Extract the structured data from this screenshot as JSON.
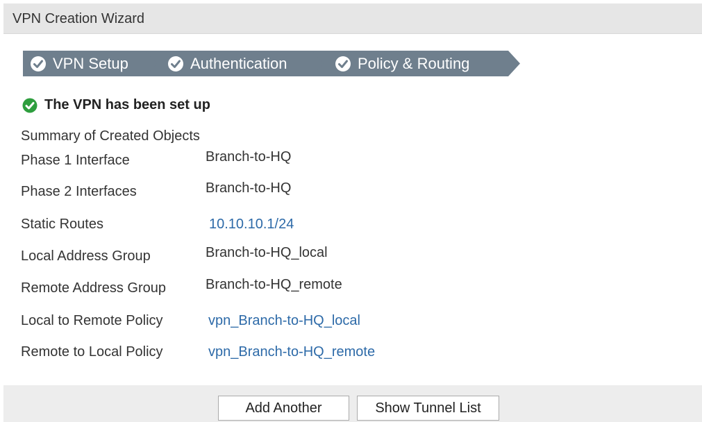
{
  "window": {
    "title": "VPN Creation Wizard"
  },
  "steps": [
    {
      "label": "VPN Setup",
      "icon": "check-circle-icon"
    },
    {
      "label": "Authentication",
      "icon": "check-circle-icon"
    },
    {
      "label": "Policy & Routing",
      "icon": "check-circle-icon"
    }
  ],
  "status": {
    "message": "The VPN has been set up",
    "icon": "success-check-icon",
    "color": "#2e9e3e"
  },
  "summary": {
    "title": "Summary of Created Objects",
    "rows": [
      {
        "label": "Phase 1 Interface",
        "value": "Branch-to-HQ"
      },
      {
        "label": "Phase 2 Interfaces",
        "value": "Branch-to-HQ"
      },
      {
        "label": "Static Routes",
        "value": "10.10.10.1/24"
      },
      {
        "label": "Local Address Group",
        "value": "Branch-to-HQ_local"
      },
      {
        "label": "Remote Address Group",
        "value": "Branch-to-HQ_remote"
      },
      {
        "label": "Local to Remote Policy",
        "value": "vpn_Branch-to-HQ_local"
      },
      {
        "label": "Remote to Local Policy",
        "value": "vpn_Branch-to-HQ_remote"
      }
    ]
  },
  "buttons": {
    "add_another": "Add Another",
    "show_tunnel_list": "Show Tunnel List"
  },
  "colors": {
    "step_bg": "#6f7f8d",
    "link": "#2d6aa8",
    "titlebar_bg": "#e6e6e6"
  }
}
